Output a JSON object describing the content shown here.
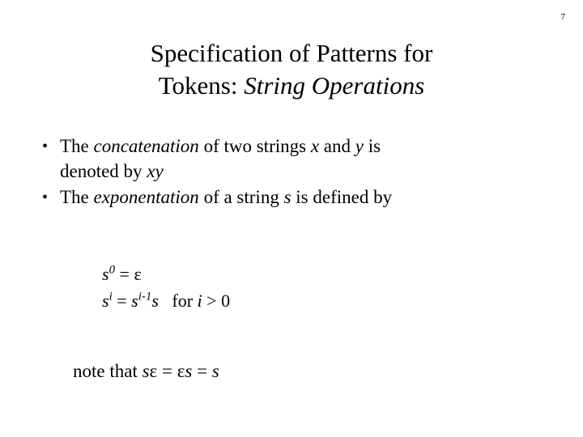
{
  "slide": {
    "page_number": "7",
    "title": {
      "line1": "Specification of Patterns for",
      "line2_prefix": "Tokens",
      "line2_colon": ":",
      "line2_italic": "String Operations"
    },
    "bullets": [
      {
        "marker": "•",
        "part1": "The ",
        "italic1": "concatenation",
        "part2": " of two strings ",
        "italic2": "x",
        "part3": " and ",
        "italic3": "y",
        "part4": " is",
        "line2_prefix": "denoted by ",
        "line2_italic": "xy"
      },
      {
        "marker": "•",
        "part1": "The ",
        "italic1": "exponentation",
        "part2": " of a string ",
        "italic2": "s",
        "part3": " is defined by"
      }
    ],
    "math": {
      "line1_base": "s",
      "line1_sup": "0",
      "line1_rest": " = ε",
      "line2_base": "s",
      "line2_sup": "i",
      "line2_eq": " = ",
      "line2_base2": "s",
      "line2_sup2": "i-1",
      "line2_base3": "s",
      "line2_cond_upright": "   for ",
      "line2_cond_italic": "i",
      "line2_cond_rest": " > 0"
    },
    "note": {
      "prefix": "note that ",
      "italic1": "s",
      "eps1": "ε",
      "eq1": " = ",
      "eps2": "ε",
      "italic2": "s",
      "eq2": " = ",
      "italic3": "s"
    }
  }
}
